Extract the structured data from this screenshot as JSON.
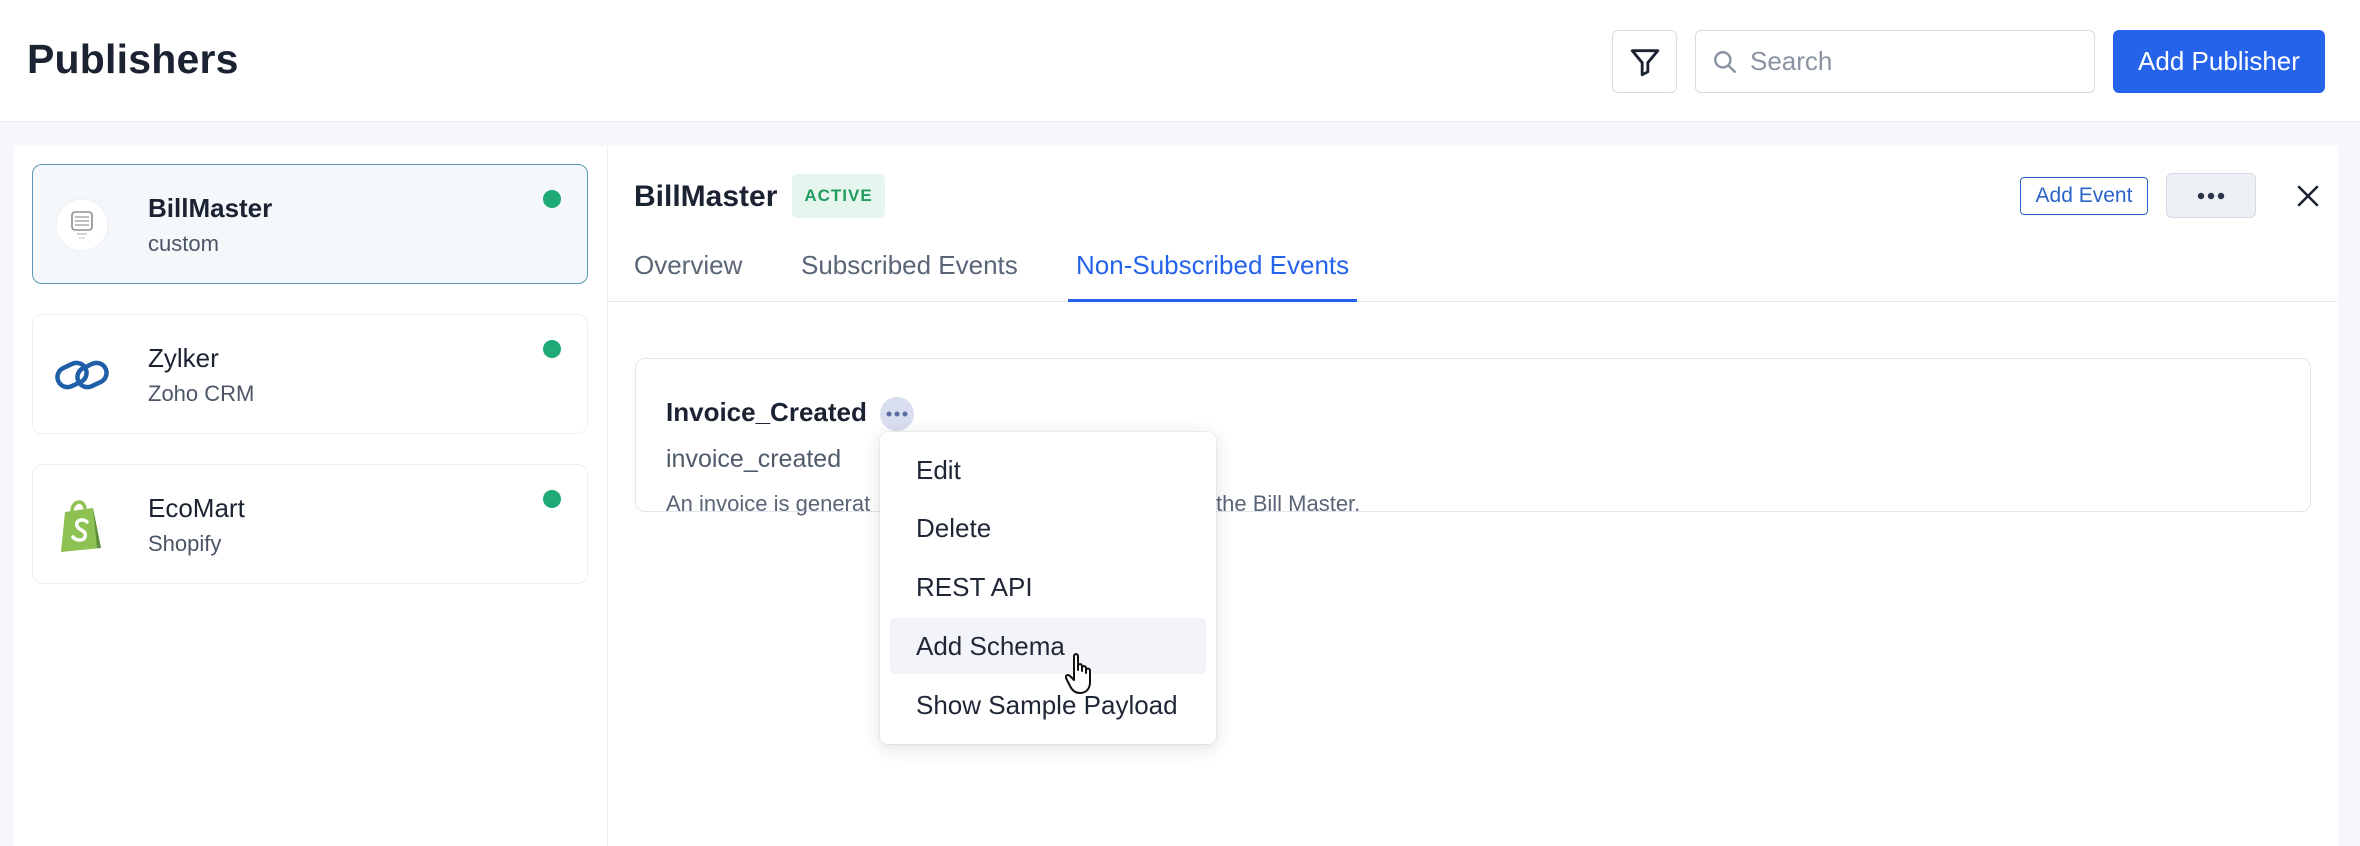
{
  "header": {
    "title": "Publishers",
    "search_placeholder": "Search",
    "add_publisher_label": "Add Publisher"
  },
  "sidebar": {
    "publishers": [
      {
        "name": "BillMaster",
        "source": "custom",
        "status_color": "#1fa974",
        "selected": true,
        "logo": "billmaster-logo-icon"
      },
      {
        "name": "Zylker",
        "source": "Zoho CRM",
        "status_color": "#1fa974",
        "selected": false,
        "logo": "zylker-logo-icon"
      },
      {
        "name": "EcoMart",
        "source": "Shopify",
        "status_color": "#1fa974",
        "selected": false,
        "logo": "shopify-logo-icon"
      }
    ]
  },
  "detail": {
    "title": "BillMaster",
    "status": "ACTIVE",
    "add_event_label": "Add Event",
    "tabs": [
      {
        "label": "Overview",
        "active": false
      },
      {
        "label": "Subscribed Events",
        "active": false
      },
      {
        "label": "Non-Subscribed Events",
        "active": true
      }
    ],
    "event": {
      "name": "Invoice_Created",
      "key": "invoice_created",
      "description_start": "An invoice is generat",
      "description_end": "the Bill Master."
    }
  },
  "menu": {
    "items": [
      {
        "label": "Edit"
      },
      {
        "label": "Delete"
      },
      {
        "label": "REST API"
      },
      {
        "label": "Add Schema",
        "hovered": true
      },
      {
        "label": "Show Sample Payload"
      }
    ]
  },
  "colors": {
    "accent": "#2563eb",
    "active_badge_bg": "#e6f6ee",
    "active_badge_text": "#1f9d5e",
    "online_dot": "#1fa974"
  }
}
